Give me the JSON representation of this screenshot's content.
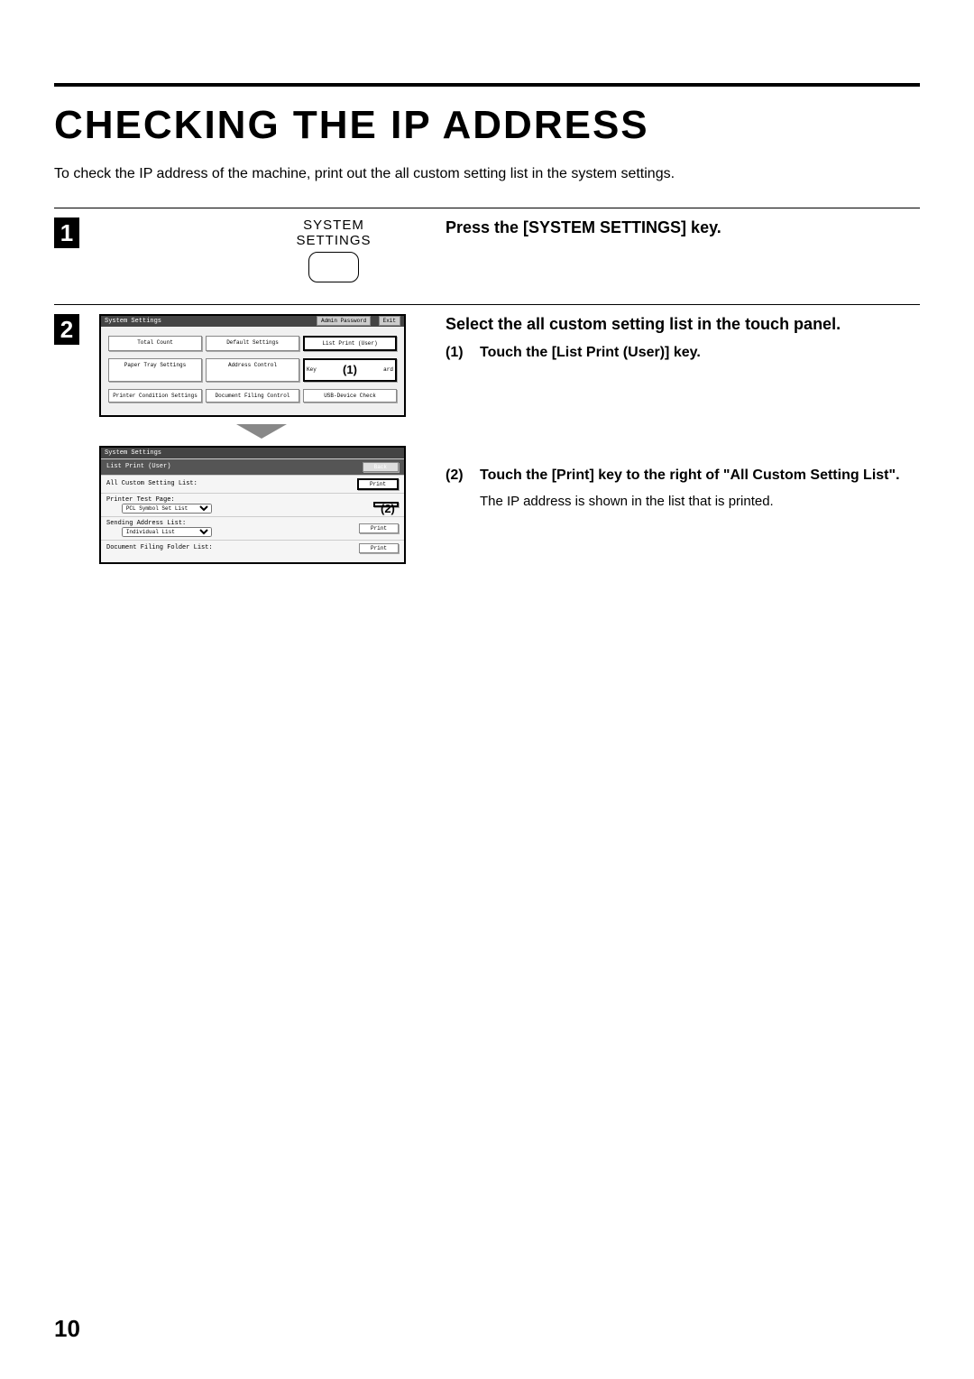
{
  "title": "CHECKING THE IP ADDRESS",
  "intro": "To check the IP address of the machine, print out the all custom setting list in the system settings.",
  "page_number": "10",
  "step1": {
    "number": "1",
    "label_line1": "SYSTEM",
    "label_line2": "SETTINGS",
    "heading": "Press the [SYSTEM SETTINGS] key."
  },
  "step2": {
    "number": "2",
    "heading": "Select the all custom setting list in the touch panel.",
    "sub1_num": "(1)",
    "sub1_text": "Touch the [List Print (User)] key.",
    "sub2_num": "(2)",
    "sub2_text": "Touch the [Print] key to the right of \"All Custom Setting List\".",
    "sub2_note": "The IP address is shown in the list that is printed.",
    "panel1": {
      "title": "System Settings",
      "admin": "Admin Password",
      "exit": "Exit",
      "btn_total": "Total Count",
      "btn_default": "Default Settings",
      "btn_list": "List Print (User)",
      "btn_paper": "Paper Tray Settings",
      "btn_addr": "Address Control",
      "btn_keyboard_left": "Key",
      "btn_keyboard_right": "ard",
      "btn_printer": "Printer Condition Settings",
      "btn_docfill": "Document Filing Control",
      "btn_usb": "USB-Device Check",
      "callout1": "(1)"
    },
    "panel2": {
      "title": "System Settings",
      "subtitle": "List Print (User)",
      "back": "Back",
      "row_all": "All Custom Setting List:",
      "row_test": "Printer Test Page:",
      "test_sel": "PCL Symbol Set List",
      "row_send": "Sending Address List:",
      "send_sel": "Individual List",
      "row_folder": "Document Filing Folder List:",
      "print": "Print",
      "callout2": "(2)"
    }
  }
}
